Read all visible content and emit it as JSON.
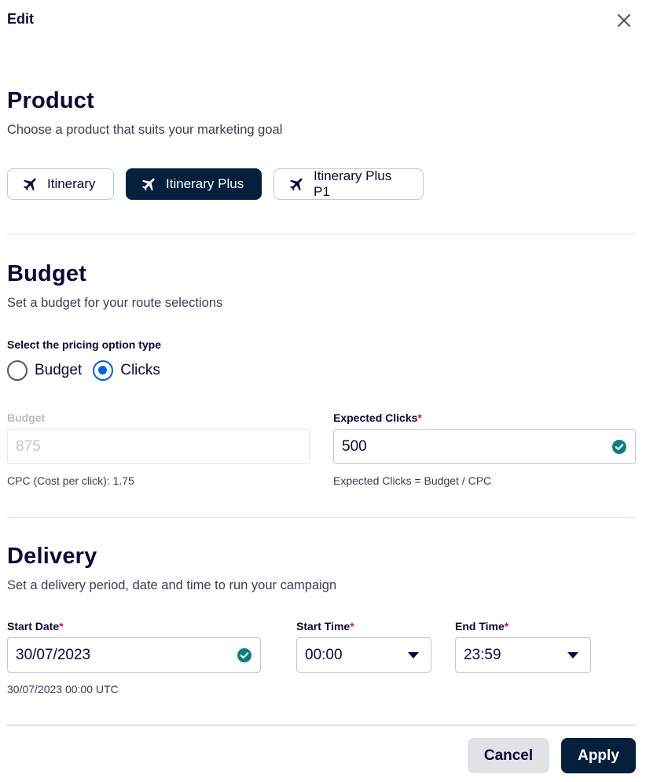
{
  "header": {
    "title": "Edit",
    "close_icon": "close-icon"
  },
  "product": {
    "title": "Product",
    "subtitle": "Choose a product that suits your marketing goal",
    "options": [
      {
        "label": "Itinerary",
        "selected": false,
        "icon": "plane-icon"
      },
      {
        "label": "Itinerary Plus",
        "selected": true,
        "icon": "plane-icon"
      },
      {
        "label": "Itinerary Plus P1",
        "selected": false,
        "icon": "plane-icon"
      }
    ]
  },
  "budget": {
    "title": "Budget",
    "subtitle": "Set a budget for your route selections",
    "pricing_label": "Select the pricing option type",
    "pricing_options": [
      {
        "label": "Budget",
        "checked": false
      },
      {
        "label": "Clicks",
        "checked": true
      }
    ],
    "budget_field": {
      "label": "Budget",
      "value": "875",
      "disabled": true,
      "helper": "CPC (Cost per click): 1.75"
    },
    "clicks_field": {
      "label": "Expected Clicks",
      "required_mark": "*",
      "value": "500",
      "helper": "Expected Clicks = Budget / CPC"
    }
  },
  "delivery": {
    "title": "Delivery",
    "subtitle": "Set a delivery period, date and time to run your campaign",
    "start_date": {
      "label": "Start Date",
      "required_mark": "*",
      "value": "30/07/2023",
      "helper": "30/07/2023 00:00 UTC"
    },
    "start_time": {
      "label": "Start Time",
      "required_mark": "*",
      "value": "00:00"
    },
    "end_time": {
      "label": "End Time",
      "required_mark": "*",
      "value": "23:59"
    }
  },
  "footer": {
    "cancel_label": "Cancel",
    "apply_label": "Apply"
  },
  "colors": {
    "primary_dark": "#05203c",
    "radio_blue": "#0062e3",
    "check_teal": "#0e7e7e",
    "required_pink": "#e70866"
  }
}
